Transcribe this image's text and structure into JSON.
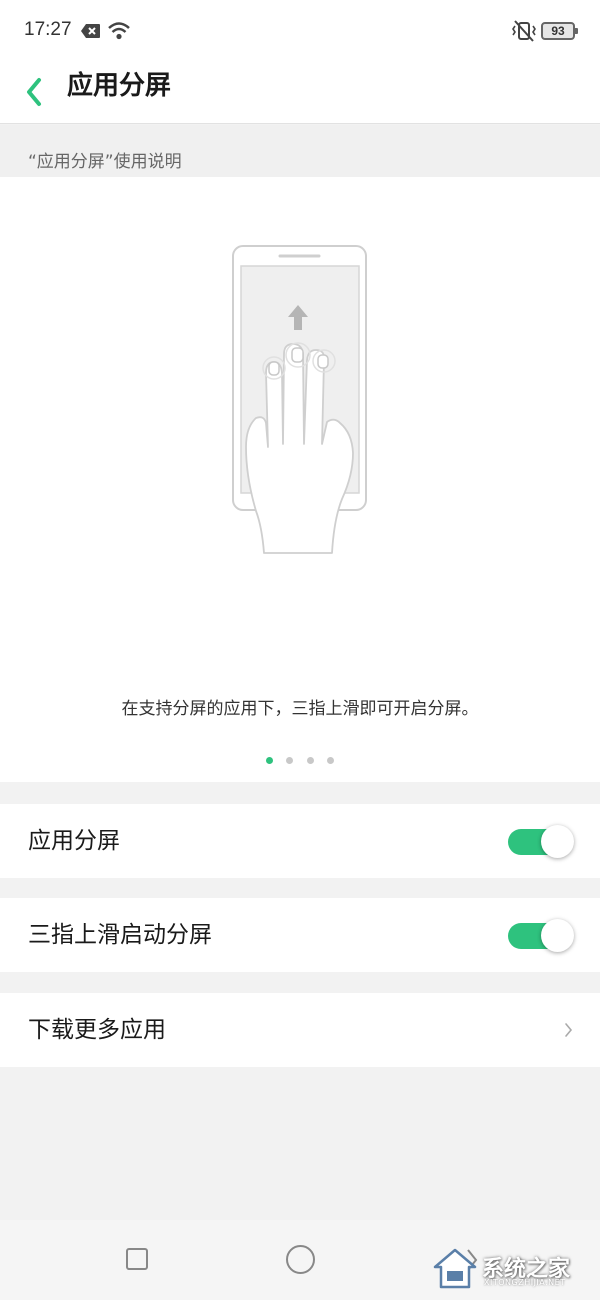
{
  "status_bar": {
    "time": "17:27",
    "battery": "93",
    "icons": [
      "x-notification-icon",
      "wifi-icon",
      "vibrate-icon",
      "battery-icon"
    ]
  },
  "app_bar": {
    "title": "应用分屏",
    "back_icon": "chevron-left-icon"
  },
  "intro": {
    "section_title": "“应用分屏”使用说明",
    "instruction": "在支持分屏的应用下，三指上滑即可开启分屏。",
    "pages_total": 4,
    "current_page": 1
  },
  "settings": [
    {
      "label": "应用分屏",
      "control": "toggle",
      "on": true
    },
    {
      "label": "三指上滑启动分屏",
      "control": "toggle",
      "on": true
    },
    {
      "label": "下载更多应用",
      "control": "chevron"
    }
  ],
  "colors": {
    "accent": "#2ec27e",
    "background": "#f2f2f2",
    "card": "#ffffff"
  },
  "nav_bar": {
    "icons": [
      "recent-apps-icon",
      "home-icon",
      "back-icon"
    ]
  },
  "watermark": {
    "text": "系统之家",
    "url": "XITONGZHIJIA.NET"
  }
}
